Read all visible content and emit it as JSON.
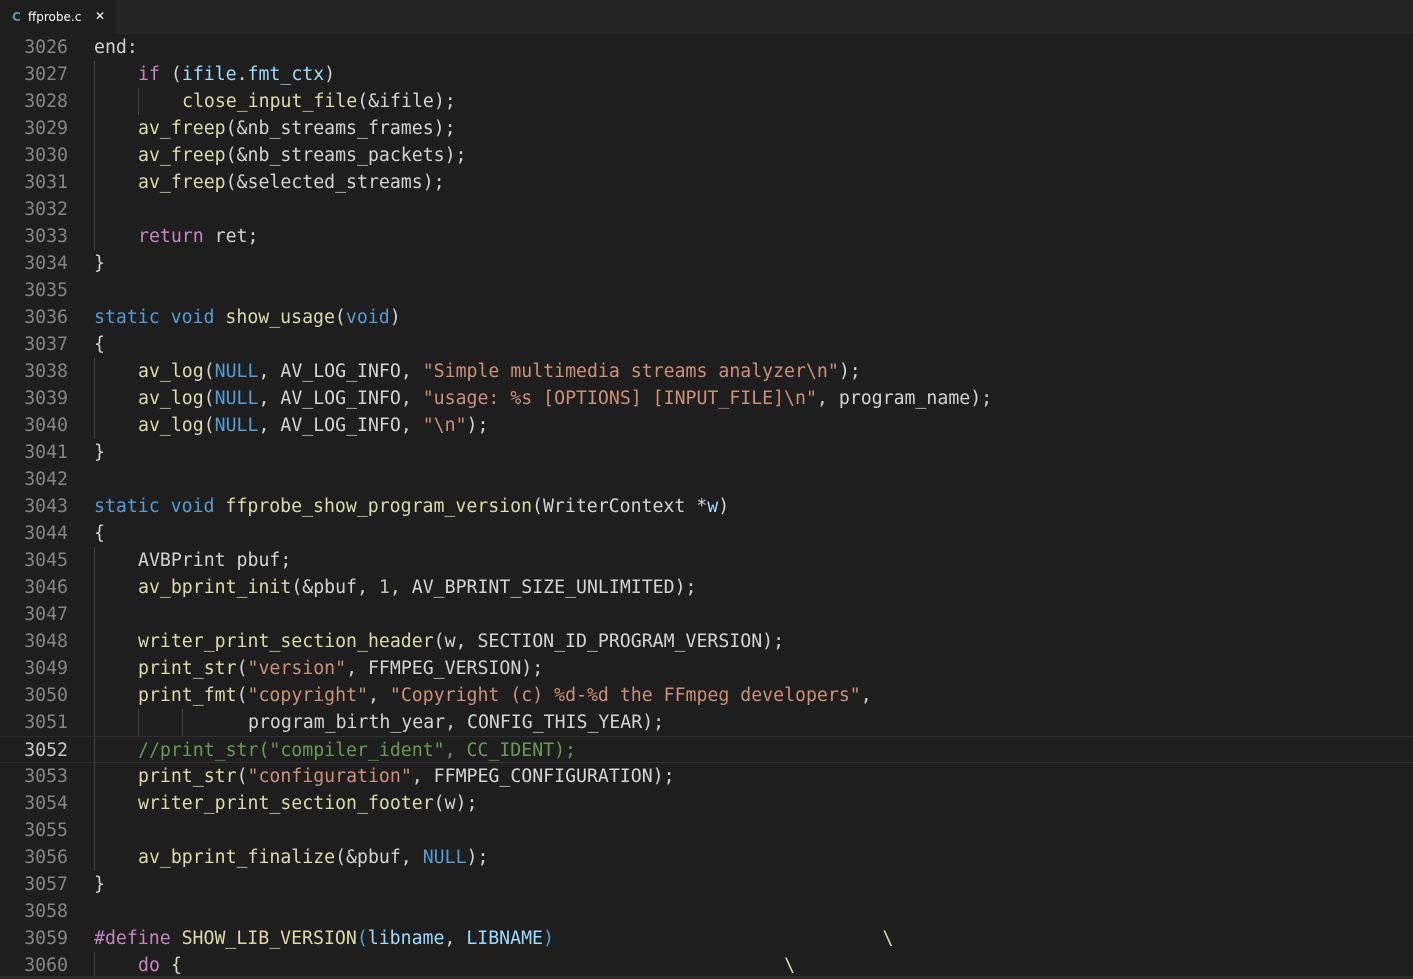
{
  "tab": {
    "icon": "c-language-icon",
    "icon_label": "C",
    "filename": "ffprobe.c",
    "close_glyph": "✕"
  },
  "colors": {
    "background": "#1e1e1e",
    "keyword": "#569cd6",
    "control": "#c586c0",
    "function": "#dcdcaa",
    "string": "#ce9178",
    "number": "#b5cea8",
    "comment": "#6a9955",
    "text": "#d4d4d4",
    "line_number": "#858585"
  },
  "editor": {
    "current_line": "3052",
    "lines": [
      {
        "n": "3026",
        "indent": 0,
        "tokens": [
          [
            "txt",
            "end:"
          ]
        ]
      },
      {
        "n": "3027",
        "indent": 1,
        "tokens": [
          [
            "ctl",
            "if"
          ],
          [
            "txt",
            " ("
          ],
          [
            "var",
            "ifile"
          ],
          [
            "txt",
            "."
          ],
          [
            "var",
            "fmt_ctx"
          ],
          [
            "txt",
            ")"
          ]
        ]
      },
      {
        "n": "3028",
        "indent": 2,
        "tokens": [
          [
            "fn",
            "close_input_file"
          ],
          [
            "txt",
            "(&ifile);"
          ]
        ]
      },
      {
        "n": "3029",
        "indent": 1,
        "tokens": [
          [
            "fn",
            "av_freep"
          ],
          [
            "txt",
            "(&nb_streams_frames);"
          ]
        ]
      },
      {
        "n": "3030",
        "indent": 1,
        "tokens": [
          [
            "fn",
            "av_freep"
          ],
          [
            "txt",
            "(&nb_streams_packets);"
          ]
        ]
      },
      {
        "n": "3031",
        "indent": 1,
        "tokens": [
          [
            "fn",
            "av_freep"
          ],
          [
            "txt",
            "(&selected_streams);"
          ]
        ]
      },
      {
        "n": "3032",
        "indent": 1,
        "tokens": []
      },
      {
        "n": "3033",
        "indent": 1,
        "tokens": [
          [
            "ctl",
            "return"
          ],
          [
            "txt",
            " ret;"
          ]
        ]
      },
      {
        "n": "3034",
        "indent": 0,
        "tokens": [
          [
            "txt",
            "}"
          ]
        ]
      },
      {
        "n": "3035",
        "indent": 0,
        "tokens": []
      },
      {
        "n": "3036",
        "indent": 0,
        "tokens": [
          [
            "kw",
            "static"
          ],
          [
            "txt",
            " "
          ],
          [
            "kw",
            "void"
          ],
          [
            "txt",
            " "
          ],
          [
            "fn",
            "show_usage"
          ],
          [
            "txt",
            "("
          ],
          [
            "kw",
            "void"
          ],
          [
            "txt",
            ")"
          ]
        ]
      },
      {
        "n": "3037",
        "indent": 0,
        "tokens": [
          [
            "txt",
            "{"
          ]
        ]
      },
      {
        "n": "3038",
        "indent": 1,
        "tokens": [
          [
            "fn",
            "av_log"
          ],
          [
            "txt",
            "("
          ],
          [
            "mac",
            "NULL"
          ],
          [
            "txt",
            ", AV_LOG_INFO, "
          ],
          [
            "str",
            "\"Simple multimedia streams analyzer\\n\""
          ],
          [
            "txt",
            ");"
          ]
        ]
      },
      {
        "n": "3039",
        "indent": 1,
        "tokens": [
          [
            "fn",
            "av_log"
          ],
          [
            "txt",
            "("
          ],
          [
            "mac",
            "NULL"
          ],
          [
            "txt",
            ", AV_LOG_INFO, "
          ],
          [
            "str",
            "\"usage: %s [OPTIONS] [INPUT_FILE]\\n\""
          ],
          [
            "txt",
            ", program_name);"
          ]
        ]
      },
      {
        "n": "3040",
        "indent": 1,
        "tokens": [
          [
            "fn",
            "av_log"
          ],
          [
            "txt",
            "("
          ],
          [
            "mac",
            "NULL"
          ],
          [
            "txt",
            ", AV_LOG_INFO, "
          ],
          [
            "str",
            "\"\\n\""
          ],
          [
            "txt",
            ");"
          ]
        ]
      },
      {
        "n": "3041",
        "indent": 0,
        "tokens": [
          [
            "txt",
            "}"
          ]
        ]
      },
      {
        "n": "3042",
        "indent": 0,
        "tokens": []
      },
      {
        "n": "3043",
        "indent": 0,
        "tokens": [
          [
            "kw",
            "static"
          ],
          [
            "txt",
            " "
          ],
          [
            "kw",
            "void"
          ],
          [
            "txt",
            " "
          ],
          [
            "fn",
            "ffprobe_show_program_version"
          ],
          [
            "txt",
            "(WriterContext *"
          ],
          [
            "var",
            "w"
          ],
          [
            "txt",
            ")"
          ]
        ]
      },
      {
        "n": "3044",
        "indent": 0,
        "tokens": [
          [
            "txt",
            "{"
          ]
        ]
      },
      {
        "n": "3045",
        "indent": 1,
        "tokens": [
          [
            "txt",
            "AVBPrint pbuf;"
          ]
        ]
      },
      {
        "n": "3046",
        "indent": 1,
        "tokens": [
          [
            "fn",
            "av_bprint_init"
          ],
          [
            "txt",
            "(&pbuf, "
          ],
          [
            "num",
            "1"
          ],
          [
            "txt",
            ", AV_BPRINT_SIZE_UNLIMITED);"
          ]
        ]
      },
      {
        "n": "3047",
        "indent": 1,
        "tokens": []
      },
      {
        "n": "3048",
        "indent": 1,
        "tokens": [
          [
            "fn",
            "writer_print_section_header"
          ],
          [
            "txt",
            "(w, SECTION_ID_PROGRAM_VERSION);"
          ]
        ]
      },
      {
        "n": "3049",
        "indent": 1,
        "tokens": [
          [
            "fn",
            "print_str"
          ],
          [
            "txt",
            "("
          ],
          [
            "str",
            "\"version\""
          ],
          [
            "txt",
            ", FFMPEG_VERSION);"
          ]
        ]
      },
      {
        "n": "3050",
        "indent": 1,
        "tokens": [
          [
            "fn",
            "print_fmt"
          ],
          [
            "txt",
            "("
          ],
          [
            "str",
            "\"copyright\""
          ],
          [
            "txt",
            ", "
          ],
          [
            "str",
            "\"Copyright (c) %d-%d the FFmpeg developers\""
          ],
          [
            "txt",
            ","
          ]
        ]
      },
      {
        "n": "3051",
        "indent": 3,
        "guides": 3,
        "pad": 1,
        "tokens": [
          [
            "txt",
            "program_birth_year, CONFIG_THIS_YEAR);"
          ]
        ]
      },
      {
        "n": "3052",
        "indent": 1,
        "tokens": [
          [
            "cmt",
            "//print_str(\"compiler_ident\", CC_IDENT);"
          ]
        ]
      },
      {
        "n": "3053",
        "indent": 1,
        "tokens": [
          [
            "fn",
            "print_str"
          ],
          [
            "txt",
            "("
          ],
          [
            "str",
            "\"configuration\""
          ],
          [
            "txt",
            ", FFMPEG_CONFIGURATION);"
          ]
        ]
      },
      {
        "n": "3054",
        "indent": 1,
        "tokens": [
          [
            "fn",
            "writer_print_section_footer"
          ],
          [
            "txt",
            "(w);"
          ]
        ]
      },
      {
        "n": "3055",
        "indent": 1,
        "tokens": []
      },
      {
        "n": "3056",
        "indent": 1,
        "tokens": [
          [
            "fn",
            "av_bprint_finalize"
          ],
          [
            "txt",
            "(&pbuf, "
          ],
          [
            "mac",
            "NULL"
          ],
          [
            "txt",
            ");"
          ]
        ]
      },
      {
        "n": "3057",
        "indent": 0,
        "tokens": [
          [
            "txt",
            "}"
          ]
        ]
      },
      {
        "n": "3058",
        "indent": 0,
        "tokens": []
      },
      {
        "n": "3059",
        "indent": 0,
        "tokens": [
          [
            "pp",
            "#define"
          ],
          [
            "txt",
            " "
          ],
          [
            "fn",
            "SHOW_LIB_VERSION"
          ],
          [
            "kw",
            "("
          ],
          [
            "var",
            "libname"
          ],
          [
            "txt",
            ", "
          ],
          [
            "var",
            "LIBNAME"
          ],
          [
            "kw",
            ")"
          ],
          [
            "txt",
            "                              "
          ],
          [
            "fn",
            "\\"
          ]
        ]
      },
      {
        "n": "3060",
        "indent": 1,
        "tokens": [
          [
            "ctl",
            "do"
          ],
          [
            "txt",
            " "
          ],
          [
            "fn",
            "{"
          ],
          [
            "txt",
            "                                                       "
          ],
          [
            "fn",
            "\\"
          ]
        ]
      }
    ]
  }
}
